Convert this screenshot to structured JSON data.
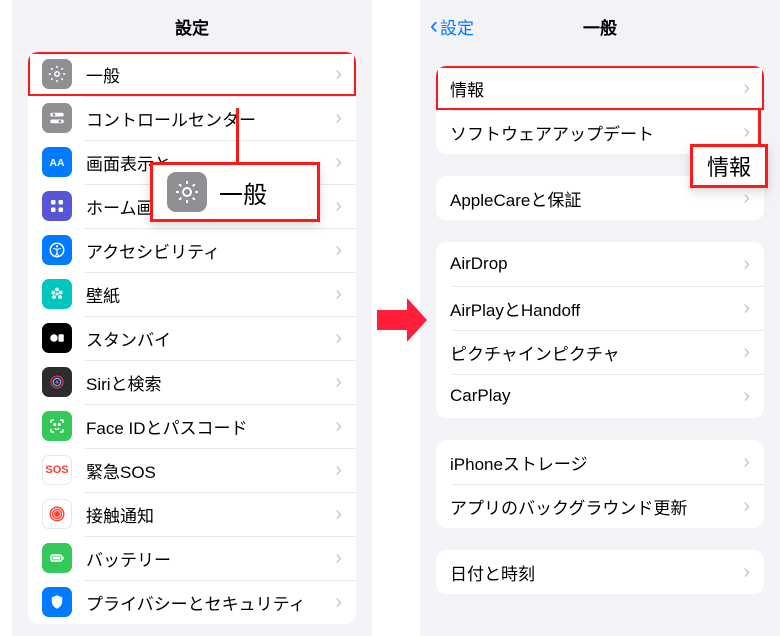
{
  "left": {
    "title": "設定",
    "rows": [
      {
        "icon": "gear",
        "label": "一般",
        "highlight": true
      },
      {
        "icon": "toggles",
        "label": "コントロールセンター"
      },
      {
        "icon": "display",
        "label": "画面表示と"
      },
      {
        "icon": "grid",
        "label": "ホーム画面"
      },
      {
        "icon": "accessibility",
        "label": "アクセシビリティ"
      },
      {
        "icon": "flower",
        "label": "壁紙"
      },
      {
        "icon": "standby",
        "label": "スタンバイ"
      },
      {
        "icon": "siri",
        "label": "Siriと検索"
      },
      {
        "icon": "faceid",
        "label": "Face IDとパスコード"
      },
      {
        "icon": "sos",
        "label": "緊急SOS"
      },
      {
        "icon": "exposure",
        "label": "接触通知"
      },
      {
        "icon": "battery",
        "label": "バッテリー"
      },
      {
        "icon": "privacy",
        "label": "プライバシーとセキュリティ"
      }
    ],
    "callout_label": "一般"
  },
  "right": {
    "back_label": "設定",
    "title": "一般",
    "groups": [
      [
        {
          "label": "情報",
          "highlight": true
        },
        {
          "label": "ソフトウェアアップデート"
        }
      ],
      [
        {
          "label": "AppleCareと保証"
        }
      ],
      [
        {
          "label": "AirDrop"
        },
        {
          "label": "AirPlayとHandoff"
        },
        {
          "label": "ピクチャインピクチャ"
        },
        {
          "label": "CarPlay"
        }
      ],
      [
        {
          "label": "iPhoneストレージ"
        },
        {
          "label": "アプリのバックグラウンド更新"
        }
      ],
      [
        {
          "label": "日付と時刻"
        }
      ]
    ],
    "callout_label": "情報"
  }
}
